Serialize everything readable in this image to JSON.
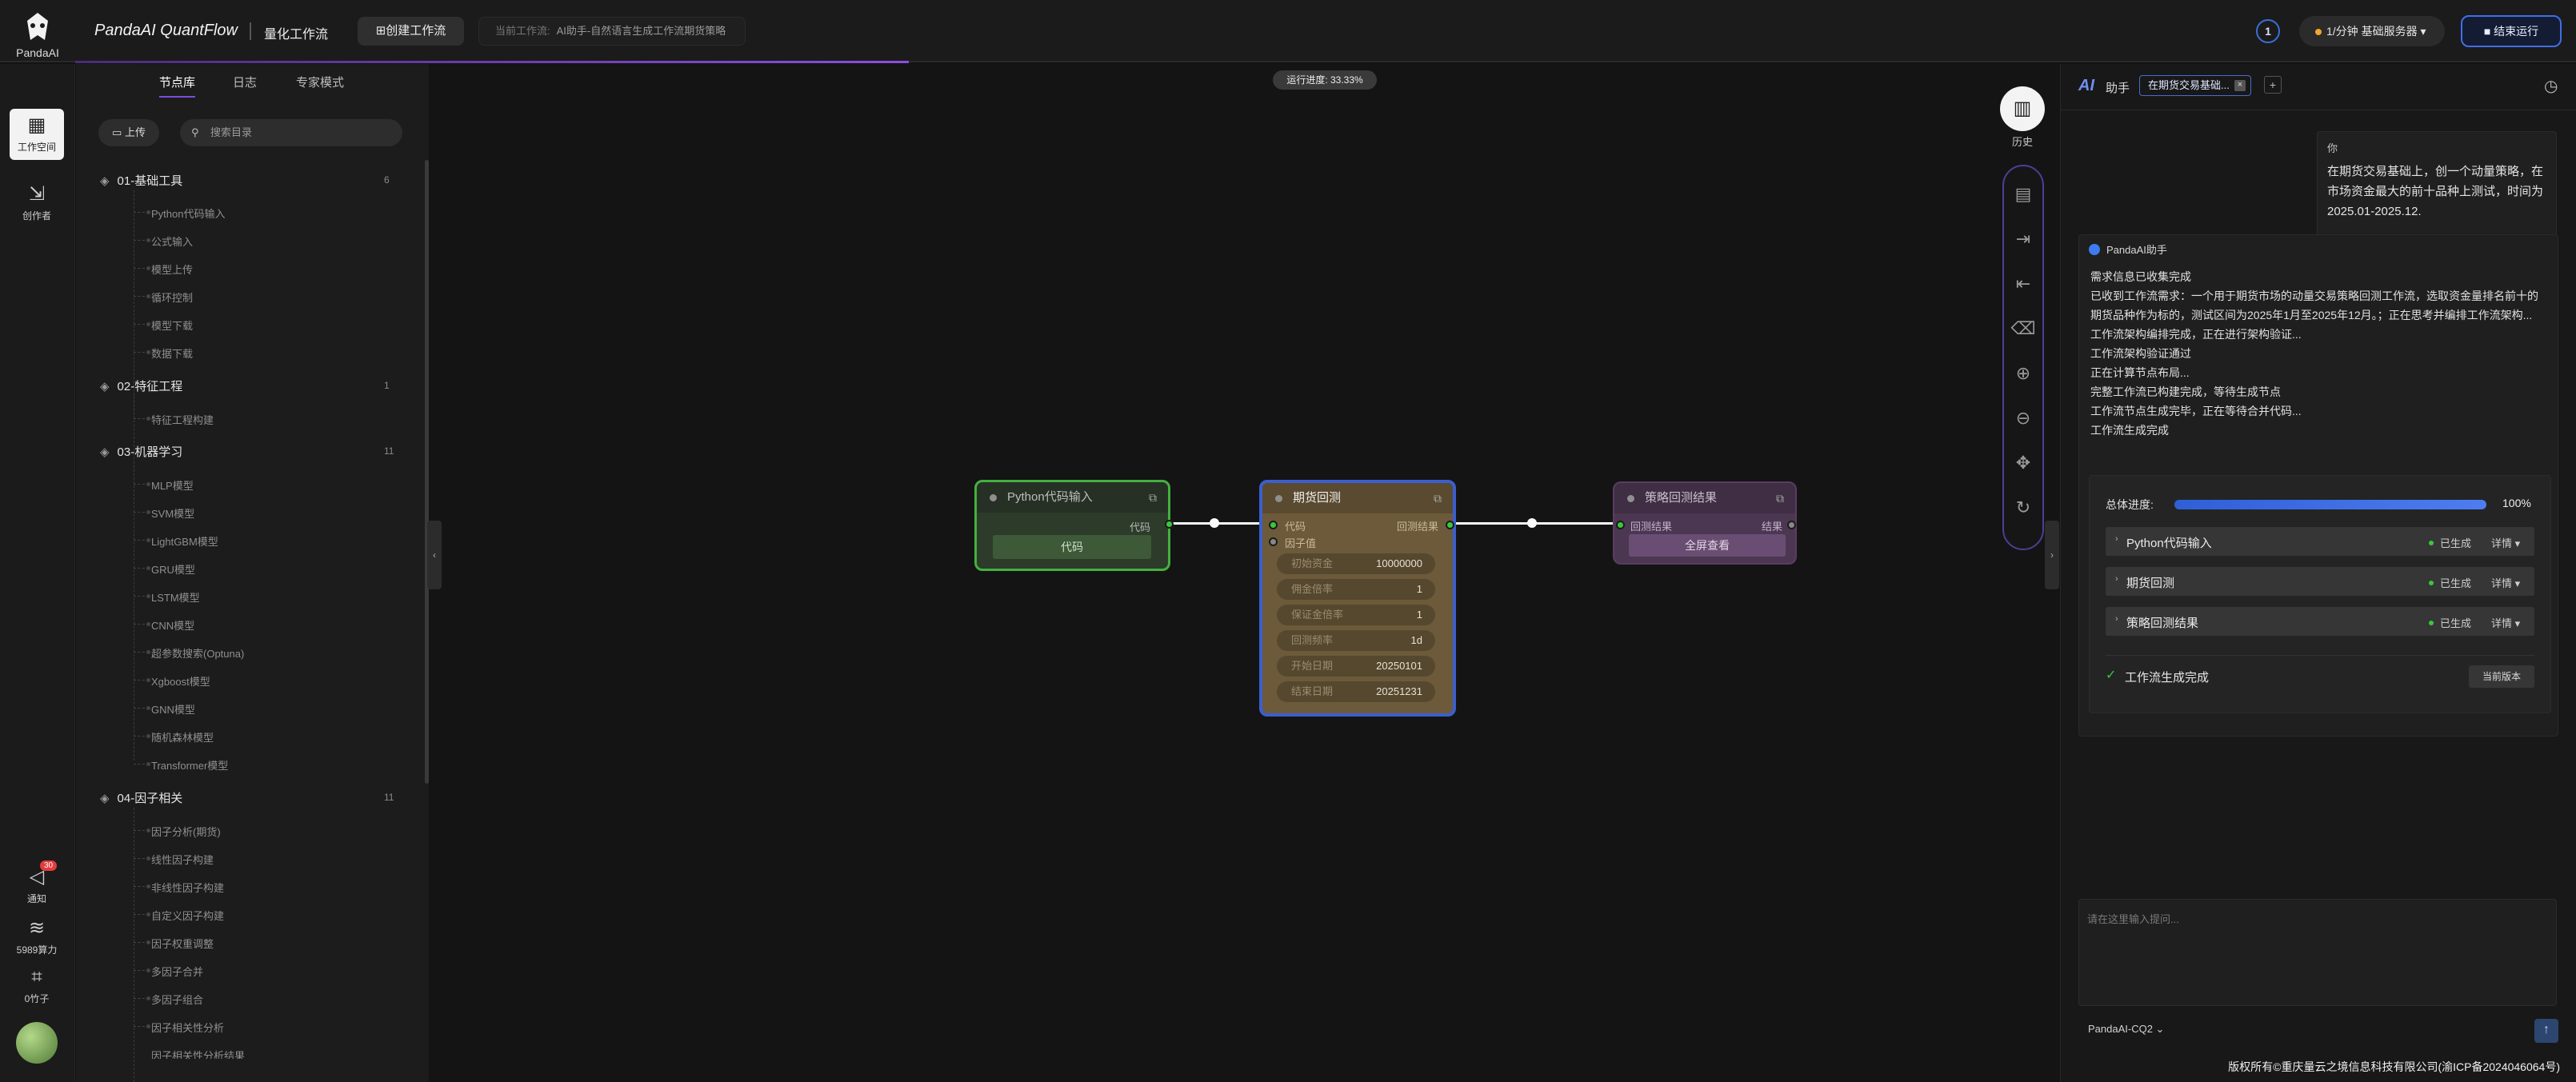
{
  "app": {
    "logo_text": "PandaAI",
    "brand": "PandaAI QuantFlow",
    "subtitle": "量化工作流"
  },
  "header": {
    "create_label": "创建工作流",
    "current_flow_label": "当前工作流:",
    "current_flow_value": "AI助手-自然语言生成工作流期货策略",
    "badge": "1",
    "server": "1/分钟  基础服务器",
    "run_label": "结束运行"
  },
  "rail": {
    "workspace": "工作空间",
    "creator": "创作者",
    "notify": "通知",
    "notify_badge": "30",
    "power": "5989算力",
    "bamboo": "0竹子"
  },
  "library": {
    "tabs": [
      "节点库",
      "日志",
      "专家模式"
    ],
    "upload": "上传",
    "search_placeholder": "搜索目录",
    "categories": [
      {
        "name": "01-基础工具",
        "count": "6",
        "items": [
          "Python代码输入",
          "公式输入",
          "模型上传",
          "循环控制",
          "模型下载",
          "数据下载"
        ]
      },
      {
        "name": "02-特征工程",
        "count": "1",
        "items": [
          "特征工程构建"
        ]
      },
      {
        "name": "03-机器学习",
        "count": "11",
        "items": [
          "MLP模型",
          "SVM模型",
          "LightGBM模型",
          "GRU模型",
          "LSTM模型",
          "CNN模型",
          "超参数搜索(Optuna)",
          "Xgboost模型",
          "GNN模型",
          "随机森林模型",
          "Transformer模型"
        ]
      },
      {
        "name": "04-因子相关",
        "count": "11",
        "items": [
          "因子分析(期货)",
          "线性因子构建",
          "非线性因子构建",
          "自定义因子构建",
          "因子权重调整",
          "多因子合并",
          "多因子组合",
          "因子相关性分析",
          "因子相关性分析结果"
        ]
      }
    ]
  },
  "canvas": {
    "run_progress": "运行进度: 33.33%",
    "history": "历史",
    "progress_fraction": 0.3333,
    "nodes": {
      "python": {
        "title": "Python代码输入",
        "out_port": "代码",
        "button": "代码"
      },
      "futures": {
        "title": "期货回测",
        "in_code": "代码",
        "in_factor": "因子值",
        "out_result": "回测结果",
        "params": [
          {
            "label": "初始资金",
            "value": "10000000"
          },
          {
            "label": "佣金倍率",
            "value": "1"
          },
          {
            "label": "保证金倍率",
            "value": "1"
          },
          {
            "label": "回测频率",
            "value": "1d"
          },
          {
            "label": "开始日期",
            "value": "20250101"
          },
          {
            "label": "结束日期",
            "value": "20251231"
          }
        ]
      },
      "result": {
        "title": "策略回测结果",
        "in_port": "回测结果",
        "out_port": "结果",
        "button": "全屏查看"
      }
    }
  },
  "assistant": {
    "title": "助手",
    "tab": "在期货交易基础...",
    "user_name": "你",
    "user_message": "在期货交易基础上，创一个动量策略，在市场资金最大的前十品种上测试，时间为2025.01-2025.12.",
    "bot_name": "PandaAI助手",
    "bot_lines": [
      "需求信息已收集完成",
      "已收到工作流需求：一个用于期货市场的动量交易策略回测工作流，选取资金量排名前十的期货品种作为标的，测试区间为2025年1月至2025年12月。；正在思考并编排工作流架构...",
      "工作流架构编排完成，正在进行架构验证...",
      "工作流架构验证通过",
      "正在计算节点布局...",
      "完整工作流已构建完成，等待生成节点",
      "工作流节点生成完毕，正在等待合并代码...",
      "工作流生成完成"
    ],
    "progress_label": "总体进度:",
    "progress_pct": "100%",
    "progress_fraction": 1.0,
    "steps": [
      {
        "name": "Python代码输入",
        "status": "已生成",
        "detail": "详情"
      },
      {
        "name": "期货回测",
        "status": "已生成",
        "detail": "详情"
      },
      {
        "name": "策略回测结果",
        "status": "已生成",
        "detail": "详情"
      }
    ],
    "done_text": "工作流生成完成",
    "version_btn": "当前版本",
    "input_placeholder": "请在这里输入提问...",
    "model": "PandaAI-CQ2",
    "copyright": "版权所有©重庆量云之境信息科技有限公司(渝ICP备2024046064号)"
  },
  "colors": {
    "accent": "#3b5fd0",
    "python_node": "#43b13e",
    "futures_node": "#6c5a3a",
    "result_node": "#4c3752",
    "status_ok": "#3ac73a"
  }
}
